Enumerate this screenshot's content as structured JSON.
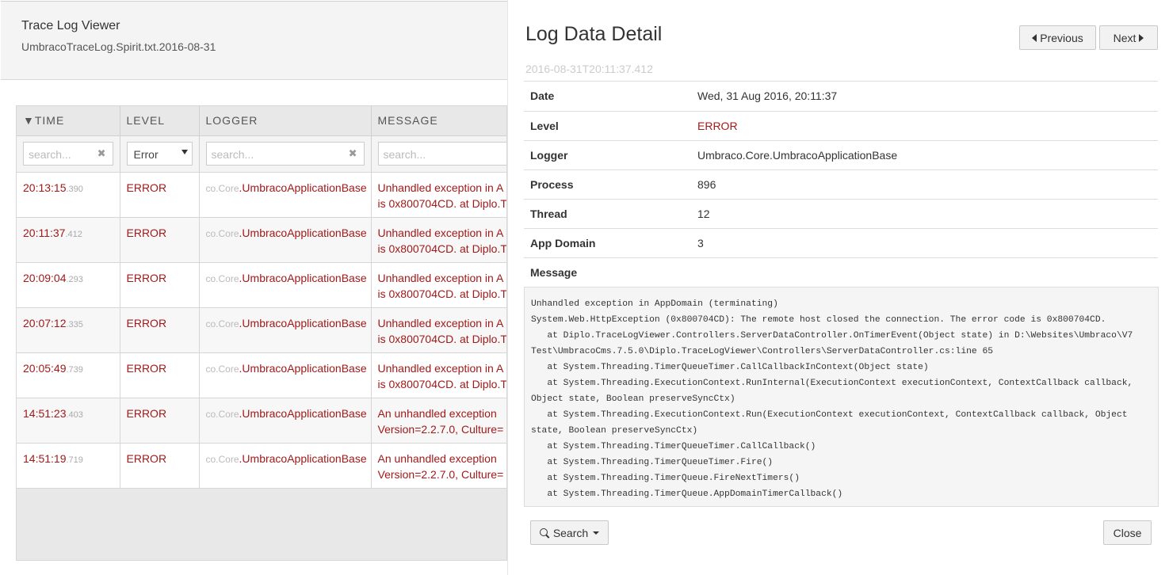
{
  "app": {
    "title": "Trace Log Viewer",
    "subtitle": "UmbracoTraceLog.Spirit.txt.2016-08-31"
  },
  "grid": {
    "headers": {
      "time": "▼TIME",
      "level": "LEVEL",
      "logger": "LOGGER",
      "message": "MESSAGE"
    },
    "filters": {
      "time_placeholder": "search...",
      "level_selected": "Error",
      "logger_placeholder": "search...",
      "message_placeholder": "search..."
    },
    "rows": [
      {
        "time": "20:13:15",
        "ms": ".390",
        "level": "ERROR",
        "logger_prefix": "co.Core",
        "logger": ".UmbracoApplicationBase",
        "msg1": "Unhandled exception in A",
        "msg2": "is 0x800704CD. at Diplo.T"
      },
      {
        "time": "20:11:37",
        "ms": ".412",
        "level": "ERROR",
        "logger_prefix": "co.Core",
        "logger": ".UmbracoApplicationBase",
        "msg1": "Unhandled exception in A",
        "msg2": "is 0x800704CD. at Diplo.T"
      },
      {
        "time": "20:09:04",
        "ms": ".293",
        "level": "ERROR",
        "logger_prefix": "co.Core",
        "logger": ".UmbracoApplicationBase",
        "msg1": "Unhandled exception in A",
        "msg2": "is 0x800704CD. at Diplo.T"
      },
      {
        "time": "20:07:12",
        "ms": ".335",
        "level": "ERROR",
        "logger_prefix": "co.Core",
        "logger": ".UmbracoApplicationBase",
        "msg1": "Unhandled exception in A",
        "msg2": "is 0x800704CD. at Diplo.T"
      },
      {
        "time": "20:05:49",
        "ms": ".739",
        "level": "ERROR",
        "logger_prefix": "co.Core",
        "logger": ".UmbracoApplicationBase",
        "msg1": "Unhandled exception in A",
        "msg2": "is 0x800704CD. at Diplo.T"
      },
      {
        "time": "14:51:23",
        "ms": ".403",
        "level": "ERROR",
        "logger_prefix": "co.Core",
        "logger": ".UmbracoApplicationBase",
        "msg1": "An unhandled exception",
        "msg2": "Version=2.2.7.0, Culture="
      },
      {
        "time": "14:51:19",
        "ms": ".719",
        "level": "ERROR",
        "logger_prefix": "co.Core",
        "logger": ".UmbracoApplicationBase",
        "msg1": "An unhandled exception",
        "msg2": "Version=2.2.7.0, Culture="
      }
    ]
  },
  "detail": {
    "title": "Log Data Detail",
    "previous_label": "Previous",
    "next_label": "Next",
    "timestamp": "2016-08-31T20:11:37.412",
    "fields": [
      {
        "key": "Date",
        "value": "Wed, 31 Aug 2016, 20:11:37"
      },
      {
        "key": "Level",
        "value": "ERROR"
      },
      {
        "key": "Logger",
        "value": "Umbraco.Core.UmbracoApplicationBase"
      },
      {
        "key": "Process",
        "value": "896"
      },
      {
        "key": "Thread",
        "value": "12"
      },
      {
        "key": "App Domain",
        "value": "3"
      },
      {
        "key": "Message",
        "value": ""
      }
    ],
    "message": "Unhandled exception in AppDomain (terminating)\nSystem.Web.HttpException (0x800704CD): The remote host closed the connection. The error code is 0x800704CD.\n   at Diplo.TraceLogViewer.Controllers.ServerDataController.OnTimerEvent(Object state) in D:\\Websites\\Umbraco\\V7 Test\\UmbracoCms.7.5.0\\Diplo.TraceLogViewer\\Controllers\\ServerDataController.cs:line 65\n   at System.Threading.TimerQueueTimer.CallCallbackInContext(Object state)\n   at System.Threading.ExecutionContext.RunInternal(ExecutionContext executionContext, ContextCallback callback, Object state, Boolean preserveSyncCtx)\n   at System.Threading.ExecutionContext.Run(ExecutionContext executionContext, ContextCallback callback, Object state, Boolean preserveSyncCtx)\n   at System.Threading.TimerQueueTimer.CallCallback()\n   at System.Threading.TimerQueueTimer.Fire()\n   at System.Threading.TimerQueue.FireNextTimers()\n   at System.Threading.TimerQueue.AppDomainTimerCallback()",
    "search_label": "Search",
    "close_label": "Close"
  },
  "colors": {
    "error": "#a01a1a",
    "header_bg": "#f4f4f4",
    "grid_bg": "#e8e8e8"
  }
}
